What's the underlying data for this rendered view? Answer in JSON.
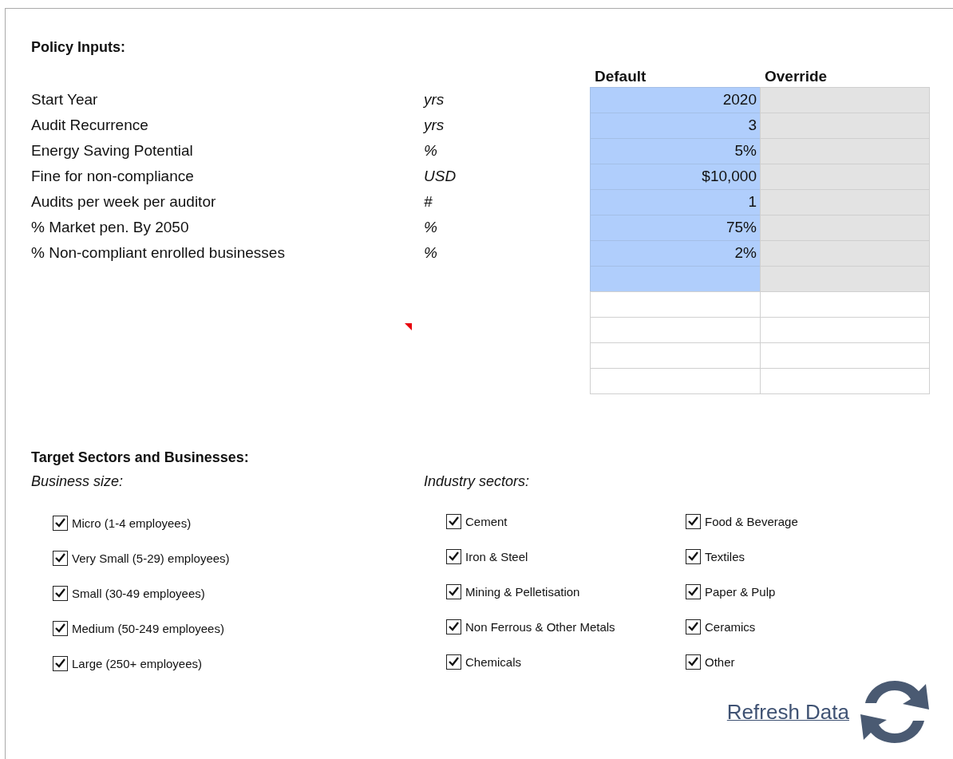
{
  "policy_inputs": {
    "title": "Policy Inputs:",
    "columns": [
      "Default",
      "Override"
    ],
    "rows": [
      {
        "kind": "input",
        "label": "Start Year",
        "unit": "yrs",
        "default": "2020"
      },
      {
        "kind": "input",
        "label": "Audit Recurrence",
        "unit": "yrs",
        "default": "3"
      },
      {
        "kind": "input",
        "label": "Energy Saving Potential",
        "unit": "%",
        "default": "5%"
      },
      {
        "kind": "input",
        "label": "Fine for non-compliance",
        "unit": "USD",
        "default": "$10,000"
      },
      {
        "kind": "input",
        "label": "Audits per week per auditor",
        "unit": "#",
        "default": "1"
      },
      {
        "kind": "input",
        "label": "% Market pen. By 2050",
        "unit": "%",
        "default": "75%"
      },
      {
        "kind": "input",
        "label": "% Non-compliant enrolled businesses",
        "unit": "%",
        "default": "2%"
      },
      {
        "kind": "input"
      },
      {
        "kind": "blank",
        "comment": true
      },
      {
        "kind": "blank"
      },
      {
        "kind": "blank"
      },
      {
        "kind": "blank"
      }
    ]
  },
  "target_sectors": {
    "title": "Target Sectors and Businesses:",
    "business_size": {
      "title": "Business size:",
      "items": [
        {
          "label": "Micro (1-4 employees)",
          "checked": true
        },
        {
          "label": "Very Small (5-29) employees)",
          "checked": true
        },
        {
          "label": "Small (30-49 employees)",
          "checked": true
        },
        {
          "label": "Medium (50-249 employees)",
          "checked": true
        },
        {
          "label": "Large (250+ employees)",
          "checked": true
        }
      ]
    },
    "industry_sectors": {
      "title": "Industry sectors:",
      "columns": [
        [
          {
            "label": "Cement",
            "checked": true
          },
          {
            "label": "Iron & Steel",
            "checked": true
          },
          {
            "label": "Mining & Pelletisation",
            "checked": true
          },
          {
            "label": "Non Ferrous & Other Metals",
            "checked": true
          },
          {
            "label": "Chemicals",
            "checked": true
          }
        ],
        [
          {
            "label": "Food & Beverage",
            "checked": true
          },
          {
            "label": "Textiles",
            "checked": true
          },
          {
            "label": "Paper & Pulp",
            "checked": true
          },
          {
            "label": "Ceramics",
            "checked": true
          },
          {
            "label": "Other",
            "checked": true
          }
        ]
      ]
    }
  },
  "refresh_link": {
    "label": "Refresh Data"
  }
}
